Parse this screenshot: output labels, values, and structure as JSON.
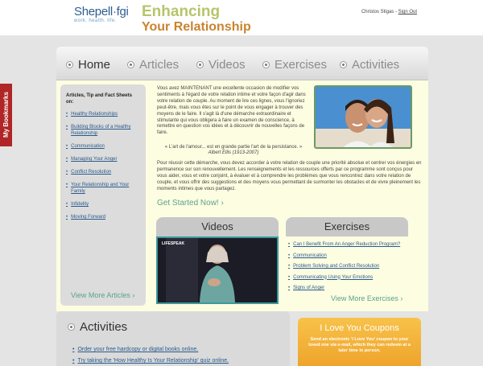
{
  "header": {
    "logo_brand": "Shepell·fgi",
    "logo_tagline": "work. health. life.",
    "title_line1": "Enhancing",
    "title_line2": "Your Relationship",
    "user_name": "Christos Stigas",
    "user_separator": "-",
    "sign_out": "Sign Out"
  },
  "bookmarks_tab": "My Bookmarks",
  "nav": {
    "items": [
      {
        "label": "Home",
        "active": true
      },
      {
        "label": "Articles",
        "active": false
      },
      {
        "label": "Videos",
        "active": false
      },
      {
        "label": "Exercises",
        "active": false
      },
      {
        "label": "Activities",
        "active": false
      }
    ]
  },
  "sidebar": {
    "title": "Articles, Tip and Fact Sheets on:",
    "links": [
      "Healthy Relationships",
      "Building Blocks of a Healthy Relationship",
      "Communication",
      "Managing Your Anger",
      "Conflict Resolution",
      "Your Relationship and Your Family",
      "Infidelity",
      "Moving Forward"
    ],
    "view_more": "View More Articles ›"
  },
  "intro": {
    "paragraph1": "Vous avez MAINTENANT une excellente occasion de modifier vos sentiments à l'égard de votre relation intime et votre façon d'agir dans votre relation de couple. Au moment de lire ces lignes, vous l'ignoriez peut-être, mais vous êtes sur le point de vous engager à trouver des moyens de le faire. Il s'agit là d'une démarche extraordinaire et stimulante qui vous obligera à faire un examen de conscience, à remettre en question vos idées et à découvrir de nouvelles façons de faire.",
    "quote": "« L'art de l'amour... est en grande partie l'art de la persistance. »",
    "quote_author": "Albert Ellis (1913-2007)",
    "paragraph2": "Pour réussir cette démarche, vous devez accorder à votre relation de couple une priorité absolue et centrer vos énergies en permanence sur son renouvellement. Les renseignements et les ressources offerts par ce programme sont conçus pour vous aider, vous et votre conjoint, à évaluer et à comprendre les problèmes que vous rencontrez dans votre relation de couple, et vous offrir des suggestions et des moyens vous permettant de surmonter les obstacles et de vivre pleinement les moments intimes que vous partagez.",
    "get_started": "Get Started Now! ›"
  },
  "videos": {
    "title": "Videos",
    "video_label": "LIFESPEAK"
  },
  "exercises": {
    "title": "Exercises",
    "items": [
      "Can I Benefit From An Anger Reduction Program?",
      "Communication",
      "Problem Solving and Conflict Resolution",
      "Communicating Using Your Emotions",
      "Signs of Anger"
    ],
    "view_more": "View More Exercises ›"
  },
  "activities": {
    "title": "Activities",
    "items": [
      "Order your free hardcopy or digital books online.",
      "Try taking the 'How Healthy Is Your Relationship' quiz online."
    ]
  },
  "coupon": {
    "title": "I Love You Coupons",
    "text": "Send an electronic 'I Love You' coupon to your loved one via e-mail, which they can redeem at a later time in person."
  },
  "colors": {
    "accent_green": "#5aa38a",
    "link_blue": "#2a5a8c",
    "bookmark_red": "#b02525",
    "coupon_orange": "#eea42c",
    "panel_bg": "#fdfde2"
  }
}
